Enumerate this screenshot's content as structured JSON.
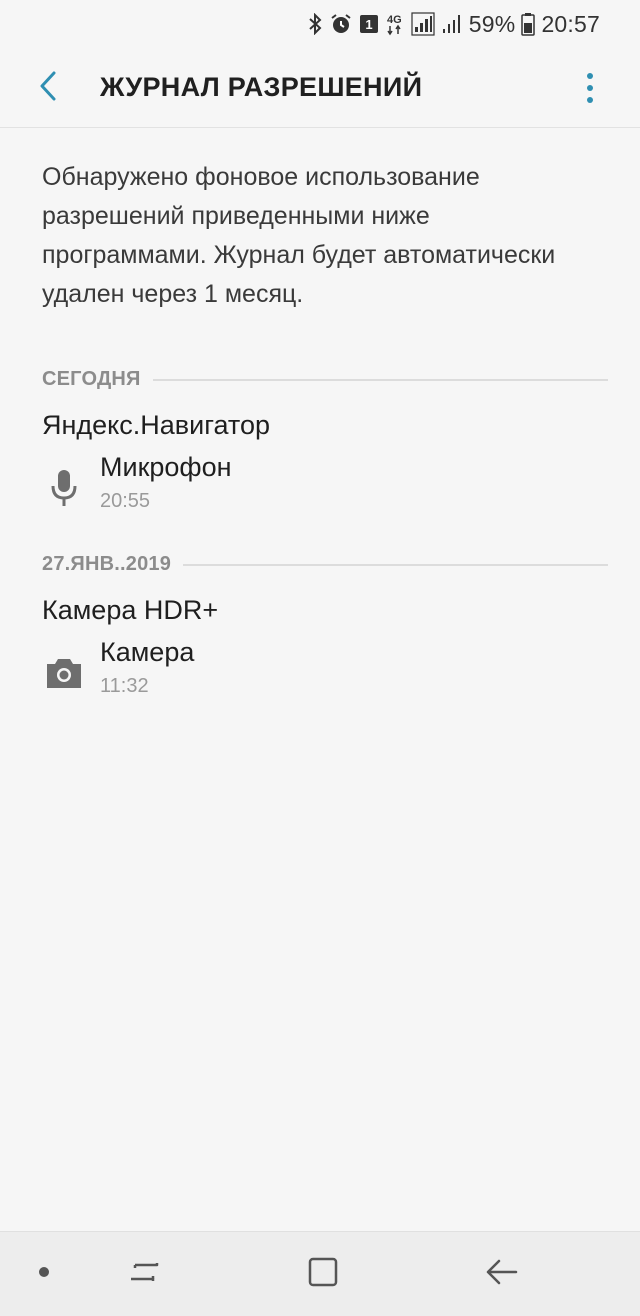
{
  "status_bar": {
    "battery_percent": "59%",
    "time": "20:57",
    "sim_badge": "1",
    "network": "4G",
    "icons": [
      "bluetooth-icon",
      "alarm-icon",
      "sim-1-icon",
      "4g-icon",
      "signal-icon",
      "signal-2-icon",
      "battery-icon"
    ]
  },
  "app_bar": {
    "title": "ЖУРНАЛ РАЗРЕШЕНИЙ",
    "back_icon": "chevron-left-icon",
    "more_icon": "more-vertical-icon",
    "accent_color": "#2f8fb2"
  },
  "description": "Обнаружено фоновое использование разрешений приведенными ниже программами. Журнал будет автоматически удален через 1 месяц.",
  "sections": [
    {
      "header": "СЕГОДНЯ",
      "app": "Яндекс.Навигатор",
      "permission": "Микрофон",
      "time": "20:55",
      "icon": "microphone-icon"
    },
    {
      "header": "27.ЯНВ..2019",
      "app": "Камера HDR+",
      "permission": "Камера",
      "time": "11:32",
      "icon": "camera-icon"
    }
  ],
  "nav_bar": {
    "items": [
      "dot-icon",
      "recent-apps-icon",
      "home-icon",
      "back-icon"
    ]
  }
}
